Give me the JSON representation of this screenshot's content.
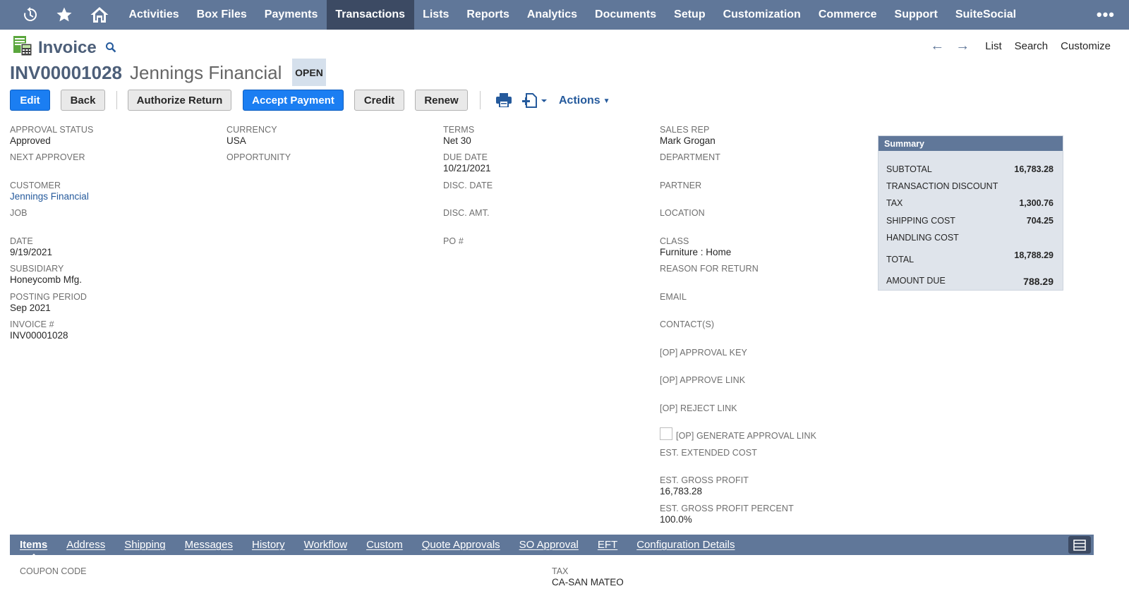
{
  "colors": {
    "nav_bg": "#607799",
    "nav_active": "#3c4a63",
    "primary_button": "#1b7ef2",
    "link": "#255a9c",
    "status_badge_bg": "#d5e0ec",
    "summary_bg": "#dfe4eb"
  },
  "topnav": {
    "icons": [
      "recent-records-icon",
      "star-icon",
      "home-icon"
    ],
    "items": [
      "Activities",
      "Box Files",
      "Payments",
      "Transactions",
      "Lists",
      "Reports",
      "Analytics",
      "Documents",
      "Setup",
      "Customization",
      "Commerce",
      "Support",
      "SuiteSocial"
    ],
    "active": "Transactions",
    "more": "•••"
  },
  "header": {
    "record_type": "Invoice",
    "links": {
      "list": "List",
      "search": "Search",
      "customize": "Customize"
    },
    "record_number": "INV00001028",
    "entity_name": "Jennings Financial",
    "status": "OPEN"
  },
  "buttons": {
    "edit": "Edit",
    "back": "Back",
    "authorize_return": "Authorize Return",
    "accept_payment": "Accept Payment",
    "credit": "Credit",
    "renew": "Renew",
    "actions": "Actions"
  },
  "fields": {
    "approval_status": {
      "label": "APPROVAL STATUS",
      "value": "Approved"
    },
    "next_approver": {
      "label": "NEXT APPROVER",
      "value": ""
    },
    "customer": {
      "label": "CUSTOMER",
      "value": "Jennings Financial"
    },
    "job": {
      "label": "JOB",
      "value": ""
    },
    "date": {
      "label": "DATE",
      "value": "9/19/2021"
    },
    "subsidiary": {
      "label": "SUBSIDIARY",
      "value": "Honeycomb Mfg."
    },
    "posting_period": {
      "label": "POSTING PERIOD",
      "value": "Sep 2021"
    },
    "invoice_no": {
      "label": "INVOICE #",
      "value": "INV00001028"
    },
    "currency": {
      "label": "CURRENCY",
      "value": "USA"
    },
    "opportunity": {
      "label": "OPPORTUNITY",
      "value": ""
    },
    "terms": {
      "label": "TERMS",
      "value": "Net 30"
    },
    "due_date": {
      "label": "DUE DATE",
      "value": "10/21/2021"
    },
    "disc_date": {
      "label": "DISC. DATE",
      "value": ""
    },
    "disc_amt": {
      "label": "DISC. AMT.",
      "value": ""
    },
    "po_no": {
      "label": "PO #",
      "value": ""
    },
    "sales_rep": {
      "label": "SALES REP",
      "value": "Mark Grogan"
    },
    "department": {
      "label": "DEPARTMENT",
      "value": ""
    },
    "partner": {
      "label": "PARTNER",
      "value": ""
    },
    "location": {
      "label": "LOCATION",
      "value": ""
    },
    "class": {
      "label": "CLASS",
      "value": "Furniture : Home"
    },
    "reason_for_return": {
      "label": "REASON FOR RETURN",
      "value": ""
    },
    "email": {
      "label": "EMAIL",
      "value": ""
    },
    "contacts": {
      "label": "CONTACT(S)",
      "value": ""
    },
    "op_approval_key": {
      "label": "[OP] APPROVAL KEY",
      "value": ""
    },
    "op_approve_link": {
      "label": "[OP] APPROVE LINK",
      "value": ""
    },
    "op_reject_link": {
      "label": "[OP] REJECT LINK",
      "value": ""
    },
    "op_generate_approval_link": {
      "label": "[OP] GENERATE APPROVAL LINK",
      "checked": false
    },
    "est_extended_cost": {
      "label": "EST. EXTENDED COST",
      "value": ""
    },
    "est_gross_profit": {
      "label": "EST. GROSS PROFIT",
      "value": "16,783.28"
    },
    "est_gross_profit_percent": {
      "label": "EST. GROSS PROFIT PERCENT",
      "value": "100.0%"
    }
  },
  "summary": {
    "title": "Summary",
    "subtotal": {
      "label": "SUBTOTAL",
      "value": "16,783.28"
    },
    "transaction_discount": {
      "label": "TRANSACTION DISCOUNT",
      "value": ""
    },
    "tax": {
      "label": "TAX",
      "value": "1,300.76"
    },
    "shipping_cost": {
      "label": "SHIPPING COST",
      "value": "704.25"
    },
    "handling_cost": {
      "label": "HANDLING COST",
      "value": ""
    },
    "total": {
      "label": "TOTAL",
      "value": "18,788.29"
    },
    "amount_due": {
      "label": "AMOUNT DUE",
      "value": "788.29"
    }
  },
  "subtabs": [
    "Items",
    "Address",
    "Shipping",
    "Messages",
    "History",
    "Workflow",
    "Custom",
    "Quote Approvals",
    "SO Approval",
    "EFT",
    "Configuration Details"
  ],
  "active_subtab": "Items",
  "items_tab": {
    "coupon_code": {
      "label": "COUPON CODE",
      "value": ""
    },
    "tax": {
      "label": "TAX",
      "value": "CA-SAN MATEO"
    }
  }
}
